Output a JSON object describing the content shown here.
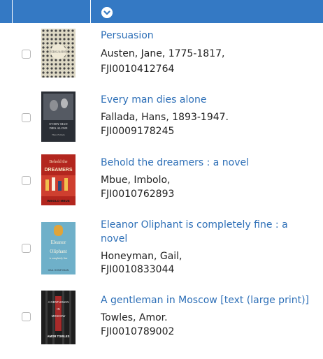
{
  "header": {
    "sort_icon": "chevron-down-circle-icon",
    "background_color": "#3479c4"
  },
  "results": [
    {
      "title": "Persuasion",
      "author": "Austen, Jane, 1775-1817,",
      "id": "FJI0010412764",
      "cover_text": [
        "PERSUASION"
      ]
    },
    {
      "title": "Every man dies alone",
      "author": "Fallada, Hans, 1893-1947.",
      "id": "FJI0009178245",
      "cover_text": [
        "EVERY MAN",
        "DIES ALONE",
        "Hans Fallada"
      ]
    },
    {
      "title": "Behold the dreamers : a novel",
      "author": "Mbue, Imbolo,",
      "id": "FJI0010762893",
      "cover_text": [
        "Behold the",
        "DREAMERS",
        "IMBOLO MBUE"
      ]
    },
    {
      "title": "Eleanor Oliphant is completely fine : a novel",
      "author": "Honeyman, Gail,",
      "id": "FJI0010833044",
      "cover_text": [
        "Eleanor",
        "Oliphant",
        "is completely fine",
        "GAIL HONEYMAN"
      ]
    },
    {
      "title": "A gentleman in Moscow [text (large print)]",
      "author": "Towles, Amor.",
      "id": "FJI0010789002",
      "cover_text": [
        "A GENTLEMAN",
        "IN",
        "MOSCOW",
        "AMOR TOWLES"
      ]
    }
  ]
}
